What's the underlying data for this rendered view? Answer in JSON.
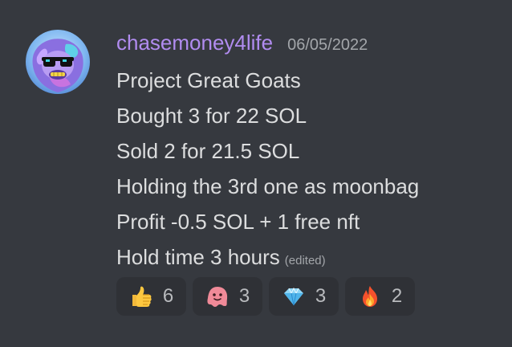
{
  "message": {
    "author": "chasemoney4life",
    "timestamp": "06/05/2022",
    "lines": [
      "Project Great Goats",
      "Bought 3 for 22 SOL",
      "Sold 2 for 21.5 SOL",
      "Holding the 3rd one as moonbag",
      "Profit -0.5 SOL + 1 free nft",
      "Hold time 3 hours"
    ],
    "edited_label": "(edited)"
  },
  "reactions": [
    {
      "emoji": "thumbs-up-icon",
      "count": "6"
    },
    {
      "emoji": "blob-face-icon",
      "count": "3"
    },
    {
      "emoji": "gem-icon",
      "count": "3"
    },
    {
      "emoji": "fire-icon",
      "count": "2"
    }
  ],
  "colors": {
    "background": "#36393f",
    "username": "#b18cf0",
    "text": "#dcddde",
    "muted": "#a3a6aa",
    "reaction_bg": "#2f3136"
  }
}
